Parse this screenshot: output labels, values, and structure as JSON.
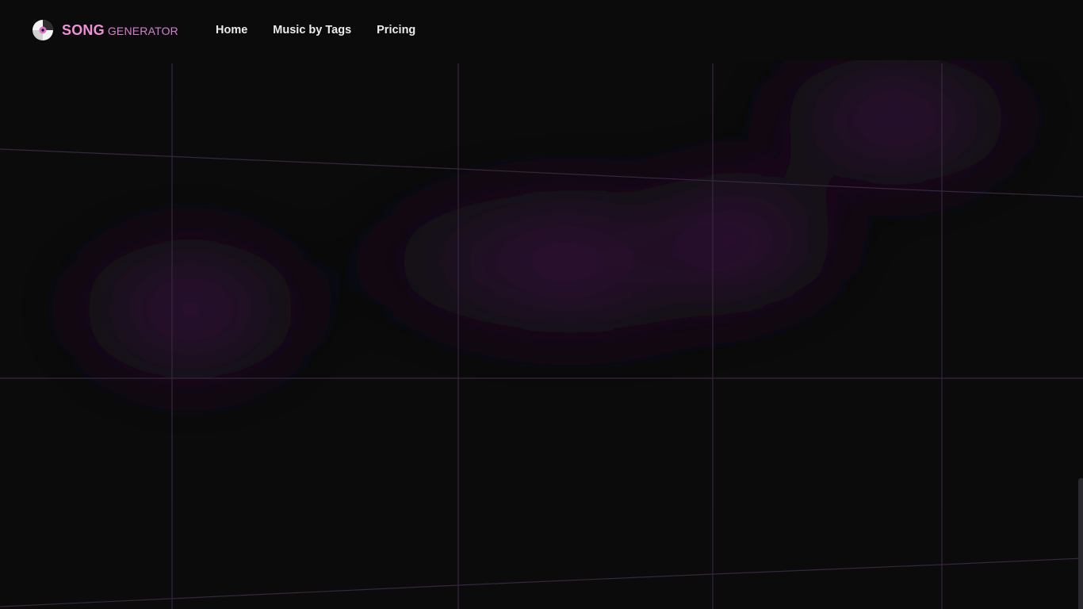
{
  "brand": {
    "primary": "SONG",
    "secondary": "GENERATOR",
    "icon": "vinyl-disc-icon"
  },
  "nav": {
    "items": [
      {
        "label": "Home"
      },
      {
        "label": "Music by Tags"
      },
      {
        "label": "Pricing"
      }
    ]
  },
  "theme": {
    "background": "#0b0b0c",
    "accent": "#f090d8",
    "glow": "#7a2a8a",
    "grid": "#3a2a42"
  }
}
